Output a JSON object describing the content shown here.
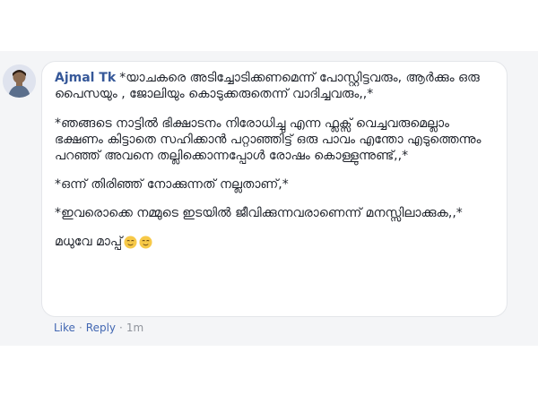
{
  "comment": {
    "author": "Ajmal Tk",
    "paragraphs": [
      "*യാചകരെ അടിച്ചോടിക്കണമെന്ന് പോസ്റ്റിട്ടവരും, ആർക്കും ഒരു പൈസയും , ജോലിയും കൊടുക്കരുതെന്ന് വാദിച്ചവരും,,*",
      "*ഞങ്ങടെ നാട്ടിൽ ഭിക്ഷാടനം നിരോധിച്ചു എന്ന ഫ്ലക്സ് വെച്ചവരുമെല്ലാം ഭക്ഷണം കിട്ടാതെ സഹിക്കാൻ പറ്റാഞ്ഞിട്ട് ഒരു പാവം എന്തോ എടുത്തെന്നും പറഞ്ഞ് അവനെ തല്ലിക്കൊന്നപ്പോൾ രോഷം കൊള്ളുന്നുണ്ട്,,*",
      "*ഒന്ന് തിരിഞ്ഞ് നോക്കുന്നത് നല്ലതാണ്,*",
      "*ഇവരൊക്കെ നമ്മുടെ ഇടയിൽ ജീവിക്കുന്നവരാണെന്ന് മനസ്സിലാക്കുക,,*",
      "മധുവേ മാപ്പ്"
    ],
    "emoji": [
      "relieved-face-icon",
      "relieved-face-icon"
    ]
  },
  "actions": {
    "like": "Like",
    "reply": "Reply",
    "separator": "·",
    "time": "1m"
  },
  "colors": {
    "author": "#365899",
    "link": "#4267b2",
    "meta": "#90949c",
    "text": "#1d2129",
    "panel": "#f4f5f7",
    "emoji": "#f7c948"
  }
}
